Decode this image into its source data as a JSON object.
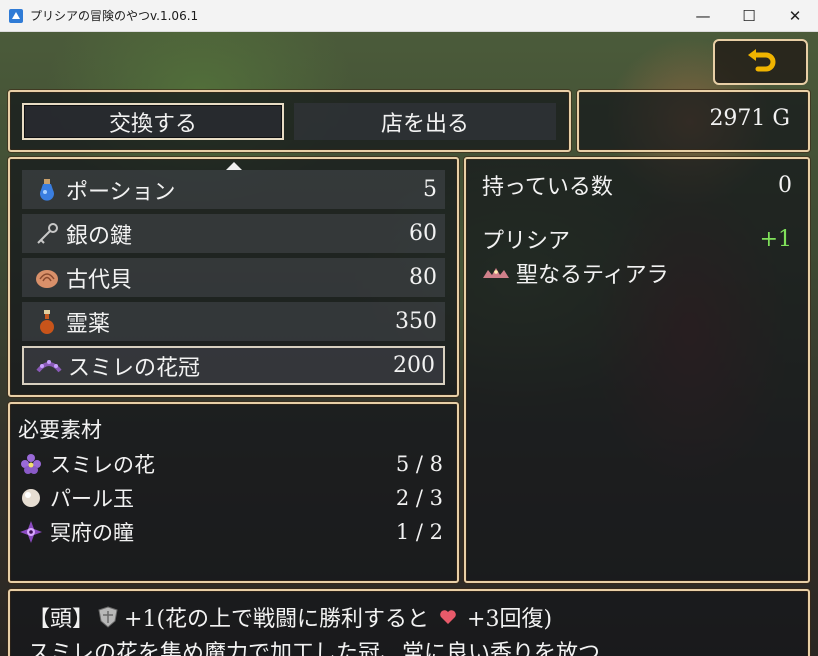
{
  "window": {
    "title": "プリシアの冒険のやつv.1.06.1",
    "minimize": "—",
    "maximize": "☐",
    "close": "✕"
  },
  "commands": [
    {
      "label": "交換する",
      "selected": true
    },
    {
      "label": "店を出る",
      "selected": false
    }
  ],
  "gold": {
    "text": "2971 G"
  },
  "items": [
    {
      "icon": "potion-icon",
      "name": "ポーション",
      "price": "5"
    },
    {
      "icon": "silver-key-icon",
      "name": "銀の鍵",
      "price": "60"
    },
    {
      "icon": "ancient-shell-icon",
      "name": "古代貝",
      "price": "80"
    },
    {
      "icon": "elixir-icon",
      "name": "霊薬",
      "price": "350"
    },
    {
      "icon": "violet-crown-icon",
      "name": "スミレの花冠",
      "price": "200",
      "selected": true
    }
  ],
  "materials": {
    "title": "必要素材",
    "list": [
      {
        "icon": "violet-flower-icon",
        "name": "スミレの花",
        "count": "5 / 8"
      },
      {
        "icon": "pearl-icon",
        "name": "パール玉",
        "count": "2 / 3"
      },
      {
        "icon": "underworld-eye-icon",
        "name": "冥府の瞳",
        "count": "1 / 2"
      }
    ]
  },
  "status": {
    "owned_label": "持っている数",
    "owned_value": "0",
    "actor_name": "プリシア",
    "actor_change": "+1",
    "equip_name": "聖なるティアラ"
  },
  "help": {
    "line1_prefix": "【頭】",
    "line1_defense": "+1(花の上で戦闘に勝利すると",
    "line1_recover": "+3回復)",
    "line2": "スミレの花を集め魔力で加工した冠、常に良い香りを放つ"
  },
  "colors": {
    "frame": "#e8cfa6",
    "plus_green": "#7fe05a",
    "back_arrow": "#f0b400"
  }
}
